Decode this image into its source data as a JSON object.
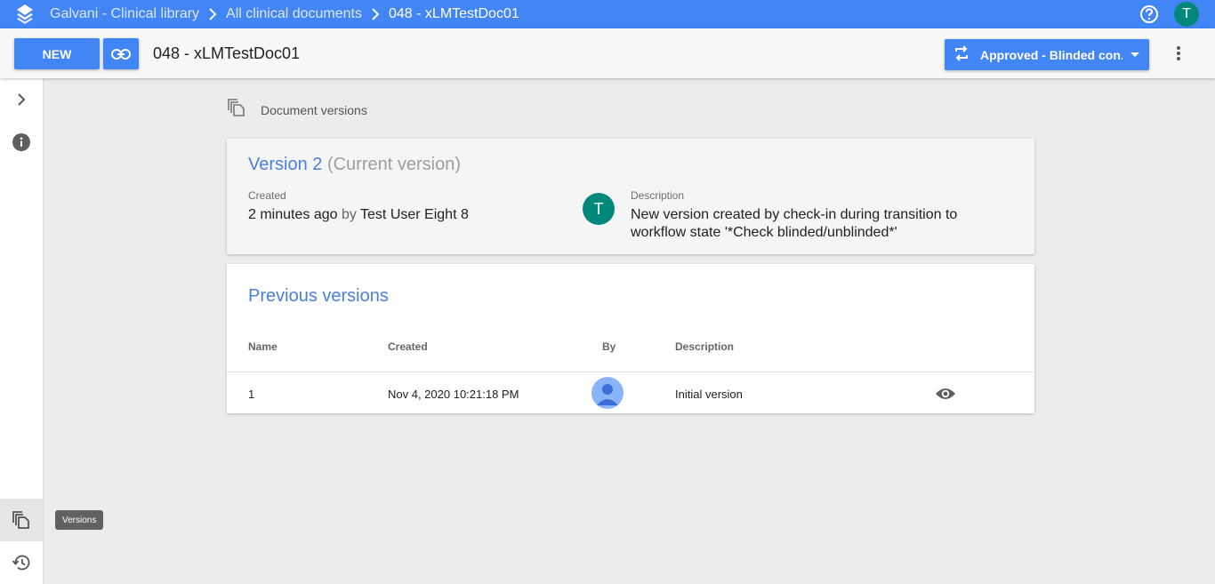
{
  "breadcrumbs": [
    "Galvani - Clinical library",
    "All clinical documents",
    "048 - xLMTestDoc01"
  ],
  "user_initial": "T",
  "toolbar": {
    "new_label": "NEW",
    "document_title": "048 - xLMTestDoc01",
    "workflow_label": "Approved - Blinded con..."
  },
  "sidebar": {
    "tooltip": "Versions"
  },
  "section_title": "Document versions",
  "current_version": {
    "title": "Version 2",
    "subtitle": "(Current version)",
    "created_label": "Created",
    "created_time": "2 minutes ago",
    "by_word": "by",
    "created_by": "Test User Eight 8",
    "avatar_initial": "T",
    "description_label": "Description",
    "description": "New version created by check-in during transition to workflow state '*Check blinded/unblinded*'"
  },
  "previous_versions": {
    "title": "Previous versions",
    "columns": [
      "Name",
      "Created",
      "By",
      "Description"
    ],
    "rows": [
      {
        "name": "1",
        "created": "Nov 4, 2020 10:21:18 PM",
        "description": "Initial version"
      }
    ]
  },
  "colors": {
    "accent": "#4285f4",
    "avatar": "#00897b",
    "link_title": "#4a7fe0"
  }
}
